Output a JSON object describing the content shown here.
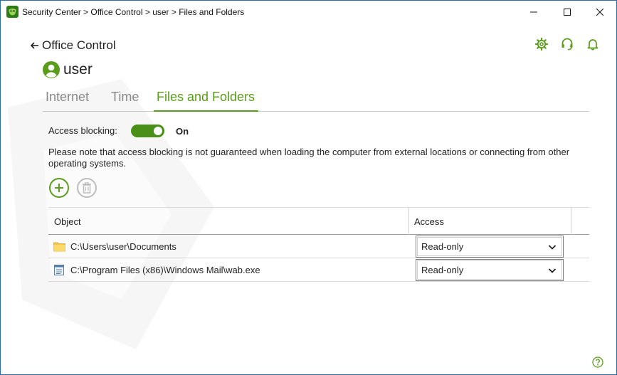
{
  "window": {
    "breadcrumb": "Security Center > Office Control > user > Files and Folders",
    "controls": [
      "minimize",
      "maximize",
      "close"
    ]
  },
  "header": {
    "back_arrow": "🡐",
    "title": "Office Control",
    "icons": [
      "gear-icon",
      "headset-icon",
      "bell-icon"
    ],
    "username": "user"
  },
  "tabs": [
    {
      "label": "Internet",
      "active": false
    },
    {
      "label": "Time",
      "active": false
    },
    {
      "label": "Files and Folders",
      "active": true
    }
  ],
  "access_blocking": {
    "label": "Access blocking:",
    "state": "On",
    "enabled": true
  },
  "note": "Please note that access blocking is not guaranteed when loading the computer from external locations or connecting from other operating systems.",
  "table": {
    "columns": [
      "Object",
      "Access"
    ],
    "rows": [
      {
        "icon": "folder-icon",
        "path": "C:\\Users\\user\\Documents",
        "access": "Read-only"
      },
      {
        "icon": "file-icon",
        "path": "C:\\Program Files (x86)\\Windows Mail\\wab.exe",
        "access": "Read-only"
      }
    ]
  },
  "colors": {
    "accent": "#5a9c1b",
    "toggle_on": "#4a9018",
    "window_border": "#2b6cb0"
  }
}
